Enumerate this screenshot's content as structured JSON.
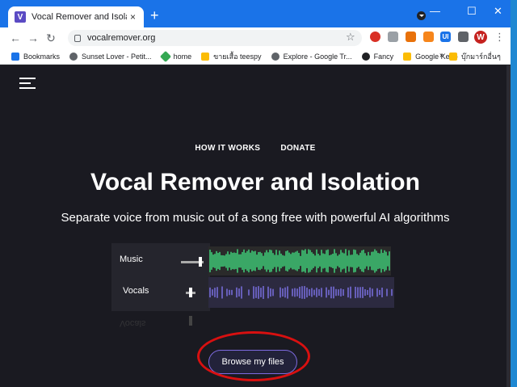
{
  "tab": {
    "title": "Vocal Remover and Isolation [AI]",
    "favicon_letter": "V",
    "close": "×"
  },
  "browser": {
    "new_tab": "+",
    "url": "vocalremover.org",
    "back": "←",
    "forward": "→",
    "reload": "↻",
    "star": "☆",
    "avatar_letter": "W",
    "menu": "⋮",
    "window_controls": {
      "minimize": "—",
      "maximize": "☐",
      "close": "✕"
    }
  },
  "bookmarks": {
    "items": [
      {
        "label": "Bookmarks",
        "color": "#1a73e8"
      },
      {
        "label": "Sunset Lover - Petit...",
        "color": "#5f6368"
      },
      {
        "label": "home",
        "color": "#34a853"
      },
      {
        "label": "ขายเสื้อ teespy",
        "color": "#fbbc04"
      },
      {
        "label": "Explore - Google Tr...",
        "color": "#5f6368"
      },
      {
        "label": "Fancy",
        "color": "#202124"
      },
      {
        "label": "Google Keep",
        "color": "#fbbc04"
      }
    ],
    "more": "»",
    "last": "บุ๊กมาร์กอื่นๆ"
  },
  "page": {
    "nav": [
      "HOW IT WORKS",
      "DONATE"
    ],
    "title": "Vocal Remover and Isolation",
    "subtitle": "Separate voice from music out of a song free with powerful AI algorithms",
    "tracks": [
      {
        "label": "Music",
        "color": "#3fd17a"
      },
      {
        "label": "Vocals",
        "color": "#7a6fe0"
      }
    ],
    "reflection": "Vocals",
    "browse_button": "Browse my files"
  },
  "colors": {
    "accent": "#7d6ae0",
    "annotation_circle": "#d81010",
    "page_bg": "#1a1a21",
    "chrome_blue": "#1a73e8"
  }
}
